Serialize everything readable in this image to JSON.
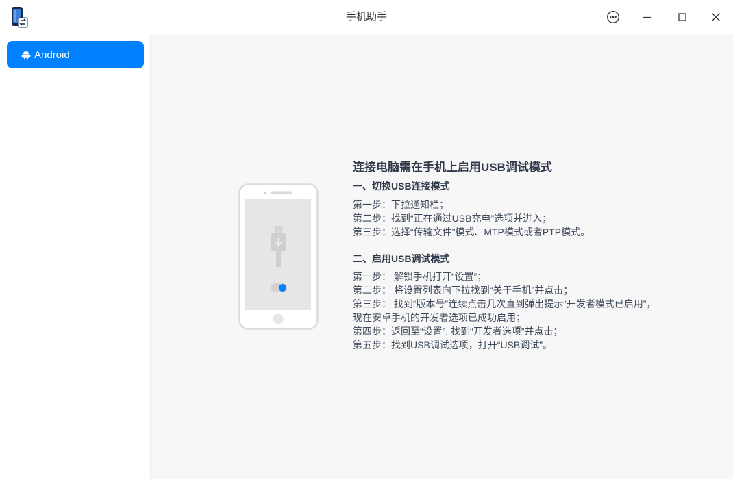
{
  "window": {
    "title": "手机助手",
    "controls": {
      "menu": "menu-icon",
      "minimize": "minimize-icon",
      "maximize": "maximize-icon",
      "close": "close-icon"
    }
  },
  "sidebar": {
    "items": [
      {
        "label": "Android",
        "icon": "android-icon",
        "selected": true
      }
    ]
  },
  "colors": {
    "accent": "#0081ff",
    "main_bg": "#f7f7f7",
    "text": "#303a4a"
  },
  "guide": {
    "title": "连接电脑需在手机上启用USB调试模式",
    "section1": {
      "title": "一、切换USB连接模式",
      "steps": [
        "第一步：下拉通知栏；",
        "第二步：找到“正在通过USB充电”选项并进入；",
        "第三步：选择“传输文件”模式、MTP模式或者PTP模式。"
      ]
    },
    "section2": {
      "title": "二、启用USB调试模式",
      "steps": [
        "第一步： 解锁手机打开“设置”；",
        "第二步： 将设置列表向下拉找到“关于手机”并点击；",
        "第三步： 找到“版本号”连续点击几次直到弹出提示“开发者模式已启用”，现在安卓手机的开发者选项已成功启用；",
        "第四步：返回至“设置”, 找到“开发者选项”并点击；",
        "第五步：找到USB调试选项，打开“USB调试”。"
      ]
    }
  }
}
